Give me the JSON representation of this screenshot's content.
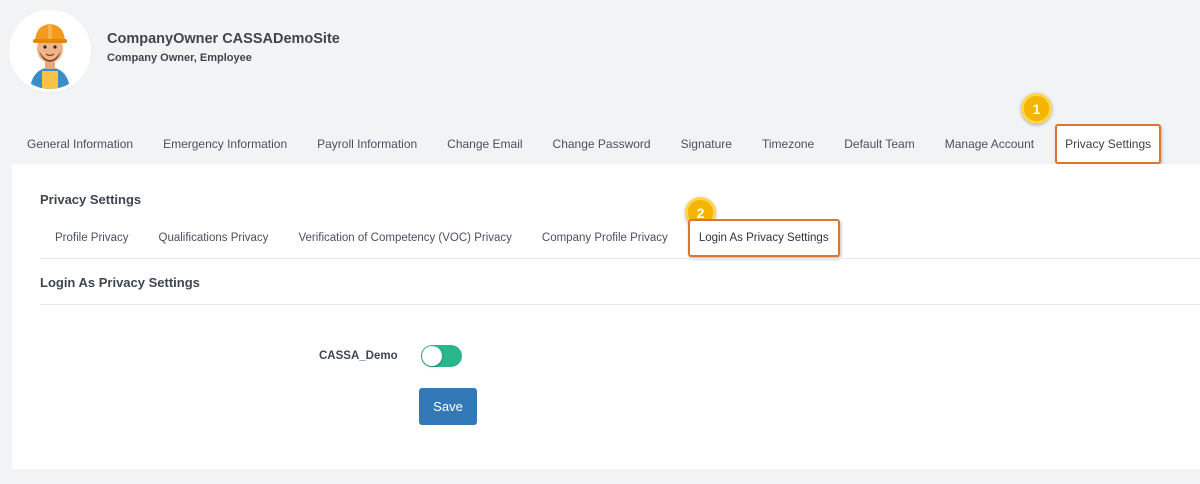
{
  "profile": {
    "name": "CompanyOwner CASSADemoSite",
    "role": "Company Owner, Employee"
  },
  "main_tabs": [
    {
      "label": "General Information"
    },
    {
      "label": "Emergency Information"
    },
    {
      "label": "Payroll Information"
    },
    {
      "label": "Change Email"
    },
    {
      "label": "Change Password"
    },
    {
      "label": "Signature"
    },
    {
      "label": "Timezone"
    },
    {
      "label": "Default Team"
    },
    {
      "label": "Manage Account"
    },
    {
      "label": "Privacy Settings",
      "active": true
    }
  ],
  "callouts": {
    "one": "1",
    "two": "2"
  },
  "section": {
    "title": "Privacy Settings"
  },
  "sub_tabs": [
    {
      "label": "Profile Privacy"
    },
    {
      "label": "Qualifications Privacy"
    },
    {
      "label": "Verification of Competency (VOC) Privacy"
    },
    {
      "label": "Company Profile Privacy"
    },
    {
      "label": "Login As Privacy Settings",
      "active": true
    }
  ],
  "panel": {
    "title": "Login As Privacy Settings",
    "setting_label": "CASSA_Demo",
    "setting_enabled": true,
    "save_label": "Save"
  },
  "colors": {
    "accent_highlight": "#d9772c",
    "badge": "#f4b400",
    "toggle_on": "#2bb58a",
    "save_button": "#3479b7"
  }
}
